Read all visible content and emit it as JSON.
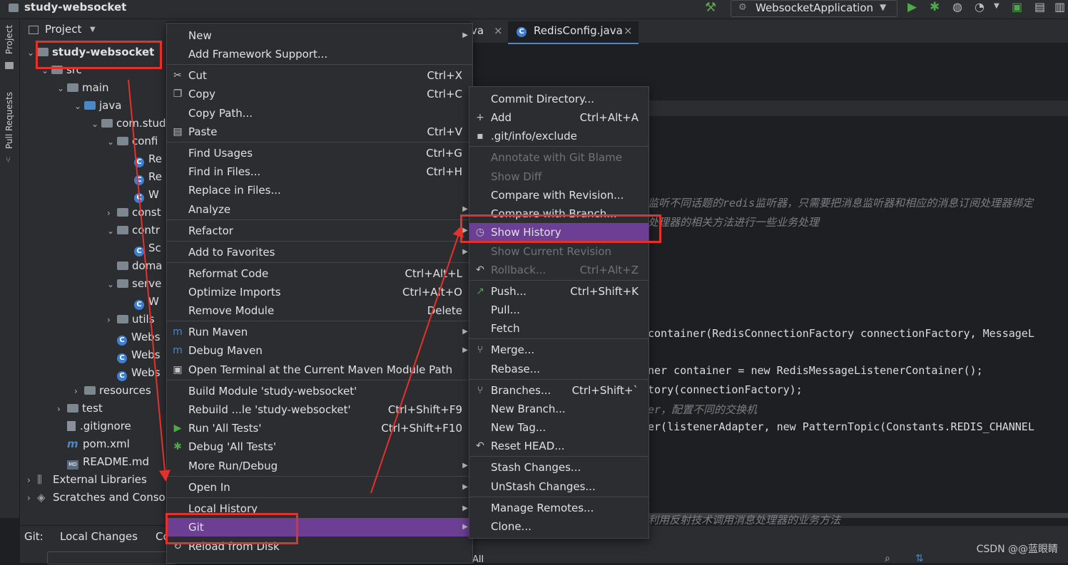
{
  "window": {
    "project_title": "study-websocket",
    "run_config": "WebsocketApplication"
  },
  "left_strip": {
    "project_tab": "Project",
    "pull_requests_tab": "Pull Requests"
  },
  "project_panel": {
    "title": "Project",
    "rows": [
      {
        "label": "study-websocket",
        "type": "module",
        "bold": true
      },
      {
        "label": "src",
        "type": "folder"
      },
      {
        "label": "main",
        "type": "folder"
      },
      {
        "label": "java",
        "type": "folder-blue"
      },
      {
        "label": "com.stud",
        "type": "package"
      },
      {
        "label": "confi",
        "type": "package"
      },
      {
        "label": "Re",
        "type": "class"
      },
      {
        "label": "Re",
        "type": "class"
      },
      {
        "label": "W",
        "type": "class"
      },
      {
        "label": "const",
        "type": "package"
      },
      {
        "label": "contr",
        "type": "package"
      },
      {
        "label": "Sc",
        "type": "class"
      },
      {
        "label": "doma",
        "type": "package"
      },
      {
        "label": "serve",
        "type": "package"
      },
      {
        "label": "W",
        "type": "class"
      },
      {
        "label": "utils",
        "type": "package"
      },
      {
        "label": "Webs",
        "type": "class"
      },
      {
        "label": "Webs",
        "type": "class"
      },
      {
        "label": "Webs",
        "type": "class"
      },
      {
        "label": "resources",
        "type": "folder"
      },
      {
        "label": "test",
        "type": "folder"
      },
      {
        "label": ".gitignore",
        "type": "file"
      },
      {
        "label": "pom.xml",
        "type": "maven"
      },
      {
        "label": "README.md",
        "type": "md"
      },
      {
        "label": "External Libraries",
        "type": "lib"
      },
      {
        "label": "Scratches and Conso",
        "type": "scratch"
      }
    ]
  },
  "tabs": {
    "tab1": "va",
    "tab2": "RedisConfig.java"
  },
  "code": {
    "comment1": "监听不同话题的redis监听器，只需要把消息监听器和相应的消息订阅处理器绑定",
    "comment2": "处理器的相关方法进行一些业务处理",
    "line1": "container(RedisConnectionFactory connectionFactory, MessageL",
    "line2": "ner container = new RedisMessageListenerContainer();",
    "line3": "tory(connectionFactory);",
    "comment3": "er，配置不同的交换机",
    "line4": "er(listenerAdapter, new PatternTopic(Constants.REDIS_CHANNEL",
    "comment4": "利用反射技术调用消息处理器的业务方法"
  },
  "bottom": {
    "git_tab": "Git:",
    "local_changes": "Local Changes",
    "co": "Co",
    "all": "All"
  },
  "context_menu": {
    "items": [
      {
        "label": "New",
        "shortcut": "",
        "submenu": true
      },
      {
        "label": "Add Framework Support...",
        "shortcut": ""
      },
      {
        "label": "Cut",
        "shortcut": "Ctrl+X",
        "icon": "cut-icon"
      },
      {
        "label": "Copy",
        "shortcut": "Ctrl+C",
        "icon": "copy-icon"
      },
      {
        "label": "Copy Path...",
        "shortcut": ""
      },
      {
        "label": "Paste",
        "shortcut": "Ctrl+V",
        "icon": "paste-icon"
      },
      {
        "label": "Find Usages",
        "shortcut": "Ctrl+G"
      },
      {
        "label": "Find in Files...",
        "shortcut": "Ctrl+H"
      },
      {
        "label": "Replace in Files...",
        "shortcut": ""
      },
      {
        "label": "Analyze",
        "shortcut": "",
        "submenu": true
      },
      {
        "label": "Refactor",
        "shortcut": "",
        "submenu": true
      },
      {
        "label": "Add to Favorites",
        "shortcut": "",
        "submenu": true
      },
      {
        "label": "Reformat Code",
        "shortcut": "Ctrl+Alt+L"
      },
      {
        "label": "Optimize Imports",
        "shortcut": "Ctrl+Alt+O"
      },
      {
        "label": "Remove Module",
        "shortcut": "Delete"
      },
      {
        "label": "Run Maven",
        "shortcut": "",
        "submenu": true,
        "icon": "maven-icon"
      },
      {
        "label": "Debug Maven",
        "shortcut": "",
        "submenu": true,
        "icon": "maven-icon"
      },
      {
        "label": "Open Terminal at the Current Maven Module Path",
        "shortcut": "",
        "icon": "terminal-icon"
      },
      {
        "label": "Build Module 'study-websocket'",
        "shortcut": ""
      },
      {
        "label": "Rebuild ...le 'study-websocket'",
        "shortcut": "Ctrl+Shift+F9"
      },
      {
        "label": "Run 'All Tests'",
        "shortcut": "Ctrl+Shift+F10",
        "icon": "run-icon"
      },
      {
        "label": "Debug 'All Tests'",
        "shortcut": "",
        "icon": "debug-icon"
      },
      {
        "label": "More Run/Debug",
        "shortcut": "",
        "submenu": true
      },
      {
        "label": "Open In",
        "shortcut": "",
        "submenu": true
      },
      {
        "label": "Local History",
        "shortcut": "",
        "submenu": true
      },
      {
        "label": "Git",
        "shortcut": "",
        "submenu": true,
        "selected": true
      },
      {
        "label": "Reload from Disk",
        "shortcut": "",
        "icon": "reload-icon"
      }
    ]
  },
  "git_menu": {
    "items": [
      {
        "label": "Commit Directory...",
        "shortcut": ""
      },
      {
        "label": "Add",
        "shortcut": "Ctrl+Alt+A",
        "icon": "plus-icon"
      },
      {
        "label": ".git/info/exclude",
        "shortcut": "",
        "icon": "file-icon"
      },
      {
        "label": "Annotate with Git Blame",
        "shortcut": "",
        "disabled": true
      },
      {
        "label": "Show Diff",
        "shortcut": "",
        "disabled": true
      },
      {
        "label": "Compare with Revision...",
        "shortcut": ""
      },
      {
        "label": "Compare with Branch...",
        "shortcut": ""
      },
      {
        "label": "Show History",
        "shortcut": "",
        "selected": true,
        "icon": "clock-icon"
      },
      {
        "label": "Show Current Revision",
        "shortcut": "",
        "disabled": true
      },
      {
        "label": "Rollback...",
        "shortcut": "Ctrl+Alt+Z",
        "disabled": true,
        "icon": "rollback-icon"
      },
      {
        "label": "Push...",
        "shortcut": "Ctrl+Shift+K",
        "icon": "push-icon"
      },
      {
        "label": "Pull...",
        "shortcut": ""
      },
      {
        "label": "Fetch",
        "shortcut": ""
      },
      {
        "label": "Merge...",
        "shortcut": "",
        "icon": "merge-icon"
      },
      {
        "label": "Rebase...",
        "shortcut": ""
      },
      {
        "label": "Branches...",
        "shortcut": "Ctrl+Shift+`",
        "icon": "branch-icon"
      },
      {
        "label": "New Branch...",
        "shortcut": ""
      },
      {
        "label": "New Tag...",
        "shortcut": ""
      },
      {
        "label": "Reset HEAD...",
        "shortcut": "",
        "icon": "reset-icon"
      },
      {
        "label": "Stash Changes...",
        "shortcut": ""
      },
      {
        "label": "UnStash Changes...",
        "shortcut": ""
      },
      {
        "label": "Manage Remotes...",
        "shortcut": ""
      },
      {
        "label": "Clone...",
        "shortcut": ""
      }
    ]
  },
  "watermark": "CSDN @@蓝眼睛",
  "colors": {
    "selection": "#6c3f94",
    "highlight_box": "#e8302a",
    "background": "#1e1f22",
    "panel": "#2b2d30"
  }
}
